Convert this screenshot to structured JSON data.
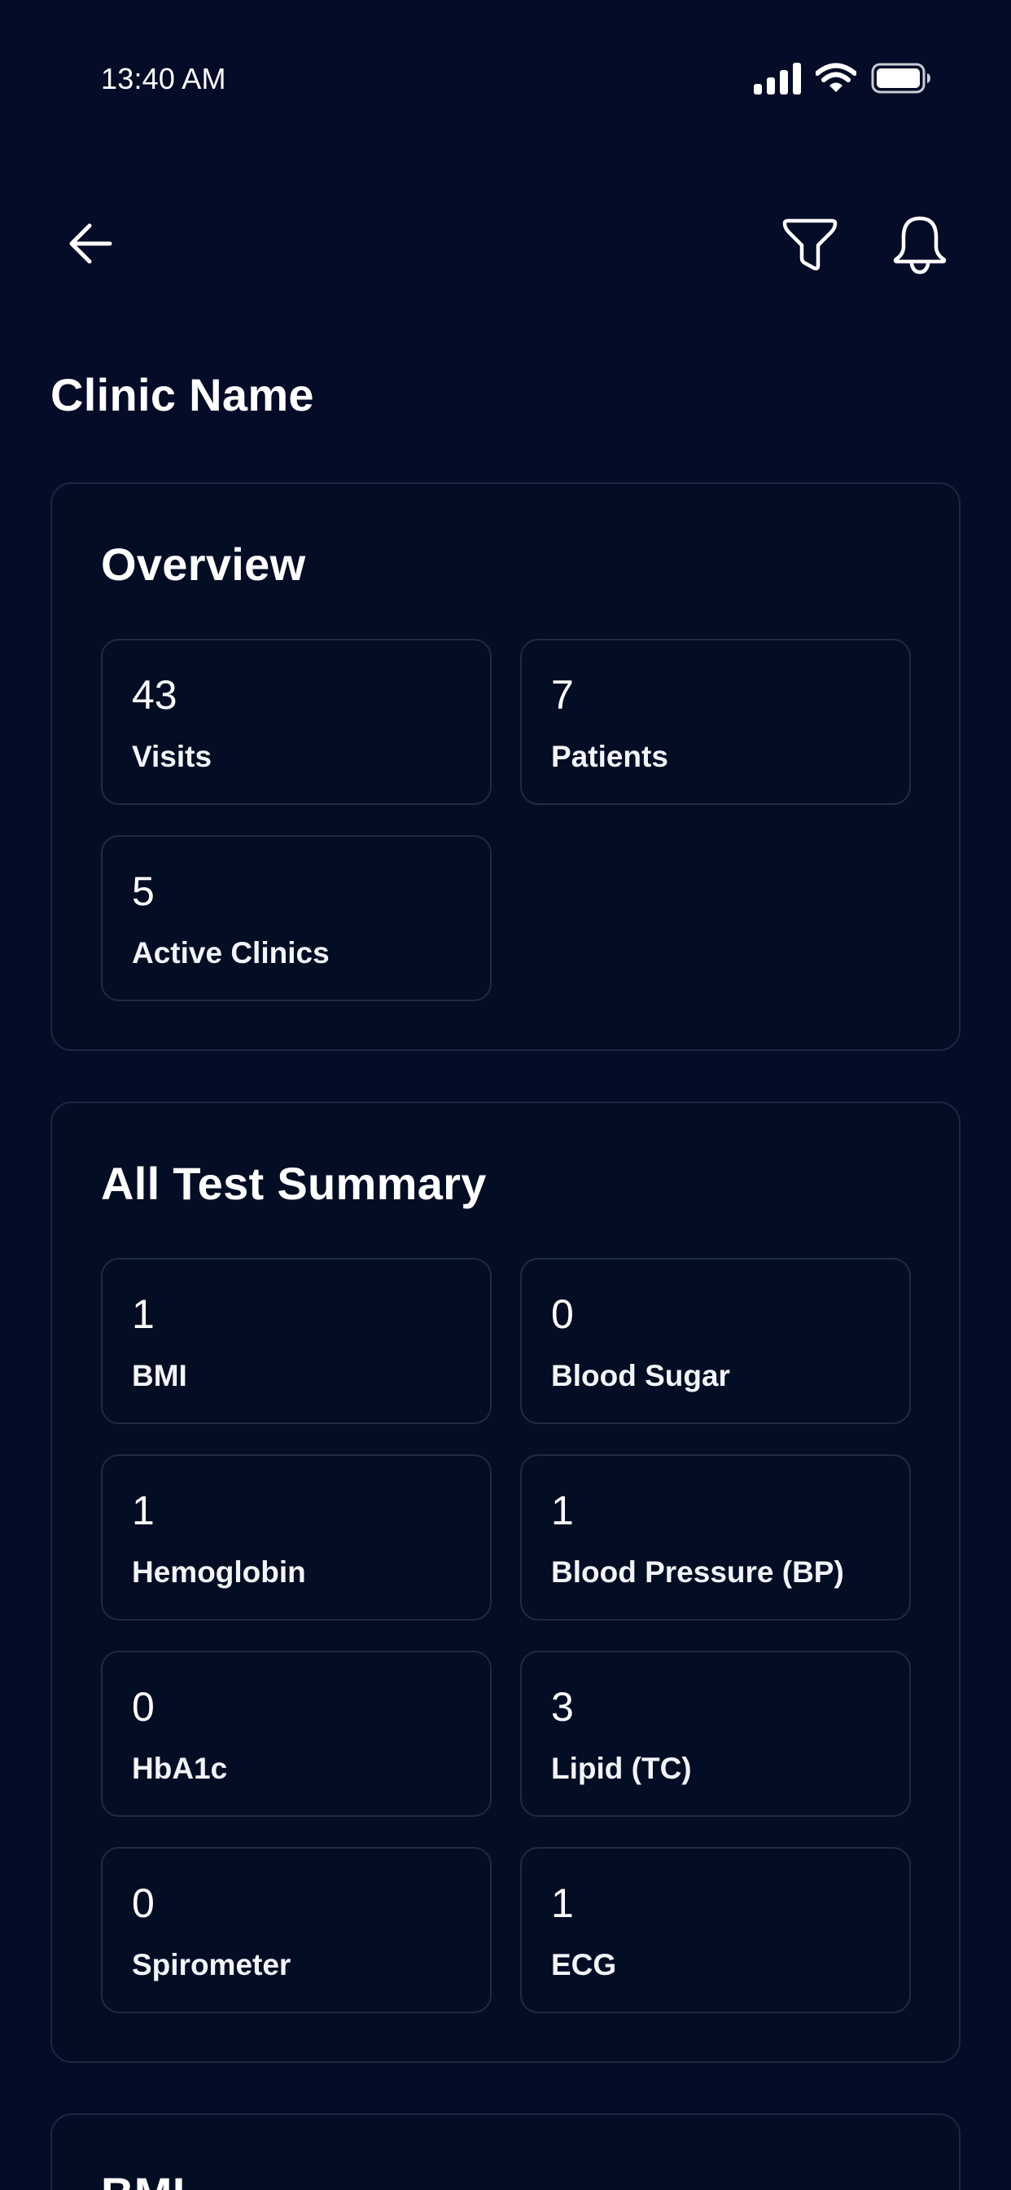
{
  "status_bar": {
    "time": "13:40 AM",
    "icons": [
      "signal-icon",
      "wifi-icon",
      "battery-icon"
    ]
  },
  "header": {
    "back_icon": "arrow-left-icon",
    "filter_icon": "filter-icon",
    "notification_icon": "bell-icon",
    "title": "Clinic Name"
  },
  "overview": {
    "title": "Overview",
    "stats": [
      {
        "value": "43",
        "label": "Visits"
      },
      {
        "value": "7",
        "label": "Patients"
      },
      {
        "value": "5",
        "label": "Active Clinics"
      }
    ]
  },
  "test_summary": {
    "title": "All Test Summary",
    "tests": [
      {
        "value": "1",
        "label": "BMI"
      },
      {
        "value": "0",
        "label": "Blood Sugar"
      },
      {
        "value": "1",
        "label": "Hemoglobin"
      },
      {
        "value": "1",
        "label": "Blood Pressure (BP)"
      },
      {
        "value": "0",
        "label": "HbA1c"
      },
      {
        "value": "3",
        "label": "Lipid (TC)"
      },
      {
        "value": "0",
        "label": "Spirometer"
      },
      {
        "value": "1",
        "label": "ECG"
      }
    ]
  },
  "bmi_section": {
    "title": "BMI"
  },
  "colors": {
    "background": "#050c27",
    "card": "#030d24",
    "border": "#1c2842",
    "text": "#ffffff"
  }
}
